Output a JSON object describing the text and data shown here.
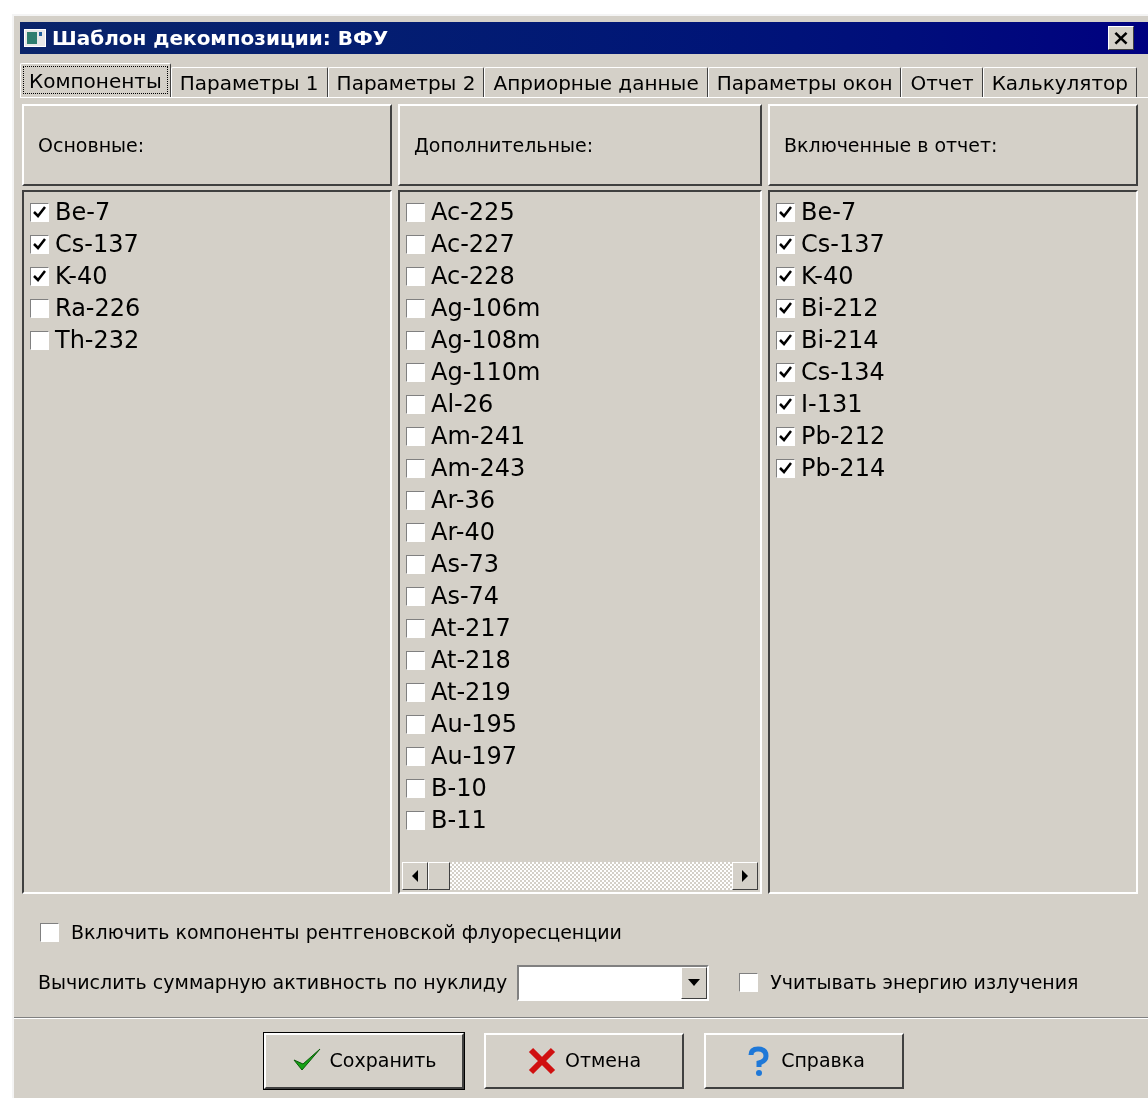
{
  "window": {
    "title": "Шаблон декомпозиции: ВФУ",
    "close": "×"
  },
  "tabs": [
    {
      "label": "Компоненты",
      "selected": true
    },
    {
      "label": "Параметры 1",
      "selected": false
    },
    {
      "label": "Параметры 2",
      "selected": false
    },
    {
      "label": "Априорные данные",
      "selected": false
    },
    {
      "label": "Параметры окон",
      "selected": false
    },
    {
      "label": "Отчет",
      "selected": false
    },
    {
      "label": "Калькулятор",
      "selected": false
    }
  ],
  "columns": [
    {
      "header": "Основные:",
      "scrollbar": false,
      "items": [
        {
          "label": "Be-7",
          "checked": true
        },
        {
          "label": "Cs-137",
          "checked": true
        },
        {
          "label": "K-40",
          "checked": true
        },
        {
          "label": "Ra-226",
          "checked": false
        },
        {
          "label": "Th-232",
          "checked": false
        }
      ]
    },
    {
      "header": "Дополнительные:",
      "scrollbar": true,
      "items": [
        {
          "label": "Ac-225",
          "checked": false
        },
        {
          "label": "Ac-227",
          "checked": false
        },
        {
          "label": "Ac-228",
          "checked": false
        },
        {
          "label": "Ag-106m",
          "checked": false
        },
        {
          "label": "Ag-108m",
          "checked": false
        },
        {
          "label": "Ag-110m",
          "checked": false
        },
        {
          "label": "Al-26",
          "checked": false
        },
        {
          "label": "Am-241",
          "checked": false
        },
        {
          "label": "Am-243",
          "checked": false
        },
        {
          "label": "Ar-36",
          "checked": false
        },
        {
          "label": "Ar-40",
          "checked": false
        },
        {
          "label": "As-73",
          "checked": false
        },
        {
          "label": "As-74",
          "checked": false
        },
        {
          "label": "At-217",
          "checked": false
        },
        {
          "label": "At-218",
          "checked": false
        },
        {
          "label": "At-219",
          "checked": false
        },
        {
          "label": "Au-195",
          "checked": false
        },
        {
          "label": "Au-197",
          "checked": false
        },
        {
          "label": "B-10",
          "checked": false
        },
        {
          "label": "B-11",
          "checked": false
        }
      ]
    },
    {
      "header": "Включенные в отчет:",
      "scrollbar": false,
      "items": [
        {
          "label": "Be-7",
          "checked": true
        },
        {
          "label": "Cs-137",
          "checked": true
        },
        {
          "label": "K-40",
          "checked": true
        },
        {
          "label": "Bi-212",
          "checked": true
        },
        {
          "label": "Bi-214",
          "checked": true
        },
        {
          "label": "Cs-134",
          "checked": true
        },
        {
          "label": "I-131",
          "checked": true
        },
        {
          "label": "Pb-212",
          "checked": true
        },
        {
          "label": "Pb-214",
          "checked": true
        }
      ]
    }
  ],
  "xrf_checkbox": {
    "label": "Включить компоненты рентгеновской флуоресценции",
    "checked": false
  },
  "nuclide_combo": {
    "label": "Вычислить суммарную активность по нуклиду"
  },
  "energy_checkbox": {
    "label": "Учитывать энергию излучения",
    "checked": false
  },
  "buttons": [
    {
      "kind": "save",
      "label": "Сохранить"
    },
    {
      "kind": "cancel",
      "label": "Отмена"
    },
    {
      "kind": "help",
      "label": "Справка"
    }
  ]
}
